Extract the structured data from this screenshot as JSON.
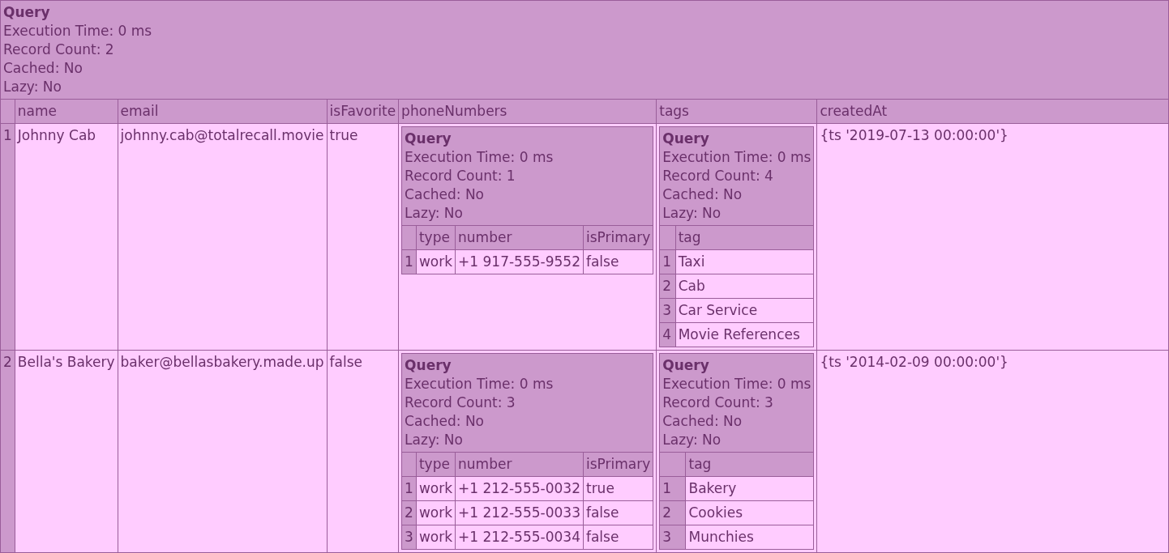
{
  "query": {
    "title": "Query",
    "meta": [
      "Execution Time: 0 ms",
      "Record Count: 2",
      "Cached: No",
      "Lazy: No"
    ],
    "columns": [
      "name",
      "email",
      "isFavorite",
      "phoneNumbers",
      "tags",
      "createdAt"
    ],
    "rows": [
      {
        "index": "1",
        "cells": [
          {
            "kind": "text",
            "text": "Johnny Cab"
          },
          {
            "kind": "text",
            "text": "johnny.cab@totalrecall.movie"
          },
          {
            "kind": "text",
            "text": "true"
          },
          {
            "kind": "query",
            "query": {
              "title": "Query",
              "meta": [
                "Execution Time: 0 ms",
                "Record Count: 1",
                "Cached: No",
                "Lazy: No"
              ],
              "columns": [
                "type",
                "number",
                "isPrimary"
              ],
              "rows": [
                {
                  "index": "1",
                  "cells": [
                    "work",
                    "+1 917-555-9552",
                    "false"
                  ]
                }
              ]
            }
          },
          {
            "kind": "query",
            "query": {
              "title": "Query",
              "meta": [
                "Execution Time: 0 ms",
                "Record Count: 4",
                "Cached: No",
                "Lazy: No"
              ],
              "columns": [
                "tag"
              ],
              "rows": [
                {
                  "index": "1",
                  "cells": [
                    "Taxi"
                  ]
                },
                {
                  "index": "2",
                  "cells": [
                    "Cab"
                  ]
                },
                {
                  "index": "3",
                  "cells": [
                    "Car Service"
                  ]
                },
                {
                  "index": "4",
                  "cells": [
                    "Movie References"
                  ]
                }
              ]
            }
          },
          {
            "kind": "text",
            "text": "{ts '2019-07-13 00:00:00'}"
          }
        ]
      },
      {
        "index": "2",
        "cells": [
          {
            "kind": "text",
            "text": "Bella's Bakery"
          },
          {
            "kind": "text",
            "text": "baker@bellasbakery.made.up"
          },
          {
            "kind": "text",
            "text": "false"
          },
          {
            "kind": "query",
            "query": {
              "title": "Query",
              "meta": [
                "Execution Time: 0 ms",
                "Record Count: 3",
                "Cached: No",
                "Lazy: No"
              ],
              "columns": [
                "type",
                "number",
                "isPrimary"
              ],
              "rows": [
                {
                  "index": "1",
                  "cells": [
                    "work",
                    "+1 212-555-0032",
                    "true"
                  ]
                },
                {
                  "index": "2",
                  "cells": [
                    "work",
                    "+1 212-555-0033",
                    "false"
                  ]
                },
                {
                  "index": "3",
                  "cells": [
                    "work",
                    "+1 212-555-0034",
                    "false"
                  ]
                }
              ]
            }
          },
          {
            "kind": "query",
            "query": {
              "title": "Query",
              "meta": [
                "Execution Time: 0 ms",
                "Record Count: 3",
                "Cached: No",
                "Lazy: No"
              ],
              "columns": [
                "tag"
              ],
              "rows": [
                {
                  "index": "1",
                  "cells": [
                    "Bakery"
                  ]
                },
                {
                  "index": "2",
                  "cells": [
                    "Cookies"
                  ]
                },
                {
                  "index": "3",
                  "cells": [
                    "Munchies"
                  ]
                }
              ]
            }
          },
          {
            "kind": "text",
            "text": "{ts '2014-02-09 00:00:00'}"
          }
        ]
      }
    ]
  }
}
